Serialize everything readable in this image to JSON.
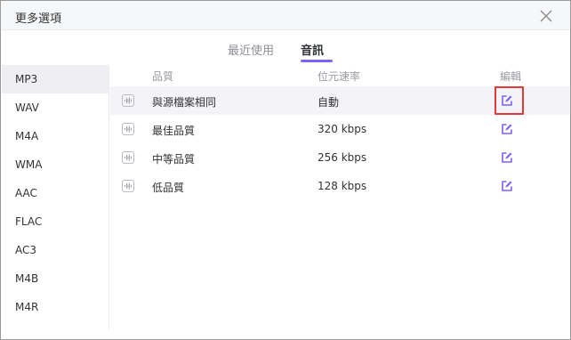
{
  "window": {
    "title": "更多選項"
  },
  "tabs": [
    {
      "label": "最近使用",
      "active": false
    },
    {
      "label": "音訊",
      "active": true
    }
  ],
  "sidebar": {
    "items": [
      {
        "label": "MP3",
        "active": true
      },
      {
        "label": "WAV"
      },
      {
        "label": "M4A"
      },
      {
        "label": "WMA"
      },
      {
        "label": "AAC"
      },
      {
        "label": "FLAC"
      },
      {
        "label": "AC3"
      },
      {
        "label": "M4B"
      },
      {
        "label": "M4R"
      }
    ]
  },
  "table": {
    "headers": {
      "quality": "品質",
      "bitrate": "位元速率",
      "edit": "編輯"
    },
    "rows": [
      {
        "quality": "與源檔案相同",
        "bitrate": "自動",
        "selected": true
      },
      {
        "quality": "最佳品質",
        "bitrate": "320 kbps"
      },
      {
        "quality": "中等品質",
        "bitrate": "256 kbps"
      },
      {
        "quality": "低品質",
        "bitrate": "128 kbps"
      }
    ]
  },
  "colors": {
    "accent": "#7b61ff",
    "highlight": "#e53935"
  }
}
